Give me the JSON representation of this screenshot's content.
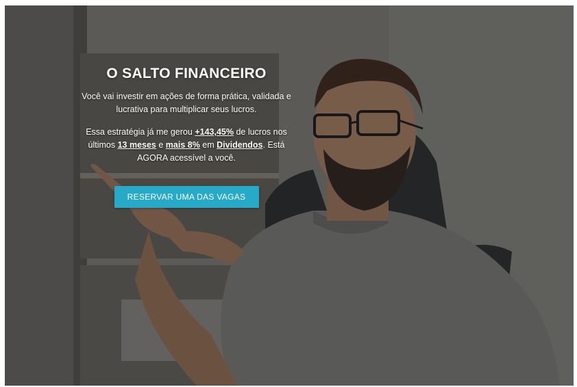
{
  "hero": {
    "title": "O SALTO FINANCEIRO",
    "line1": "Você vai investir em ações de forma prática, validada e lucrativa para multiplicar seus lucros.",
    "line2_prefix": "Essa estratégia já me gerou ",
    "line2_pct": "+143,45%",
    "line2_mid1": " de lucros nos últimos ",
    "line2_months": "13 meses",
    "line2_mid2": " e ",
    "line2_more": "mais 8%",
    "line2_mid3": " em ",
    "line2_dividends": "Dividendos",
    "line2_suffix": ". Está AGORA acessível a você."
  },
  "cta": {
    "label": "RESERVAR UMA DAS VAGAS"
  },
  "colors": {
    "cta_background": "#27a9c8",
    "text": "#ffffff"
  }
}
